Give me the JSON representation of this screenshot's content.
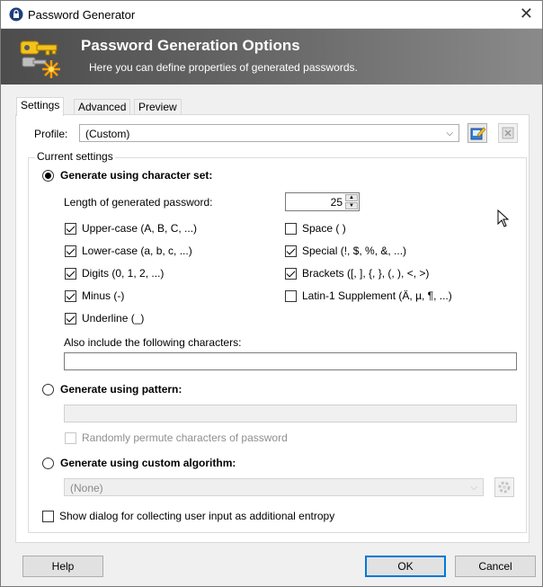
{
  "window": {
    "title": "Password Generator",
    "close_glyph": "✕"
  },
  "banner": {
    "title": "Password Generation Options",
    "subtitle": "Here you can define properties of generated passwords."
  },
  "tabs": [
    "Settings",
    "Advanced",
    "Preview"
  ],
  "profile": {
    "label": "Profile:",
    "value": "(Custom)"
  },
  "current_settings": {
    "group_title": "Current settings",
    "charset_radio_label": "Generate using character set:",
    "length_label": "Length of generated password:",
    "length_value": "25",
    "options_left": [
      {
        "label": "Upper-case (A, B, C, ...)",
        "checked": true
      },
      {
        "label": "Lower-case (a, b, c, ...)",
        "checked": true
      },
      {
        "label": "Digits (0, 1, 2, ...)",
        "checked": true
      },
      {
        "label": "Minus (-)",
        "checked": true
      },
      {
        "label": "Underline (_)",
        "checked": true
      }
    ],
    "options_right": [
      {
        "label": "Space ( )",
        "checked": false
      },
      {
        "label": "Special (!, $, %, &, ...)",
        "checked": true
      },
      {
        "label": "Brackets ([, ], {, }, (, ), <, >)",
        "checked": true
      },
      {
        "label": "Latin-1 Supplement (Ä, µ, ¶, ...)",
        "checked": false
      }
    ],
    "also_include_label": "Also include the following characters:",
    "also_include_value": "",
    "pattern_radio_label": "Generate using pattern:",
    "pattern_value": "",
    "permute_label": "Randomly permute characters of password",
    "custom_algo_radio_label": "Generate using custom algorithm:",
    "custom_algo_value": "(None)",
    "entropy_label": "Show dialog for collecting user input as additional entropy"
  },
  "buttons": {
    "help": "Help",
    "ok": "OK",
    "cancel": "Cancel"
  },
  "colors": {
    "accent": "#0078d7",
    "banner_dark": "#4c4c4c"
  }
}
